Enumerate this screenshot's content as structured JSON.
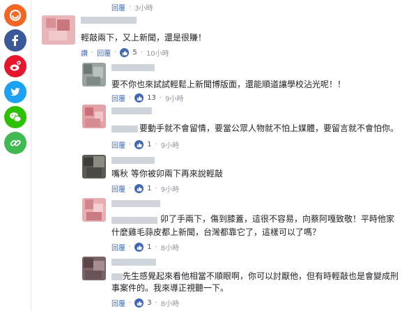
{
  "share": {
    "buttons": [
      {
        "name": "weibo-alt-icon",
        "color": "#f26522",
        "glyph": "◉"
      },
      {
        "name": "facebook-icon",
        "color": "#3b5998",
        "glyph": "f"
      },
      {
        "name": "weibo-icon",
        "color": "#e6162d",
        "glyph": "◎"
      },
      {
        "name": "twitter-icon",
        "color": "#1da1f2",
        "glyph": "✦"
      },
      {
        "name": "wechat-icon",
        "color": "#2dc100",
        "glyph": "✆"
      },
      {
        "name": "link-icon",
        "color": "#3fb950",
        "glyph": "∞"
      }
    ]
  },
  "top_actions": {
    "reply": "回覆",
    "time": "3小時"
  },
  "comments": [
    {
      "text": "輕敲兩下，又上新聞，還是很賺！",
      "like": "讚",
      "reply": "回覆",
      "count": "5",
      "time": "10小時"
    },
    {
      "text": "要不你也來試試輕鬆上新聞博版面，還能順道讓學校沾光呢！！",
      "reply": "回覆",
      "count": "13",
      "time": "9小時"
    },
    {
      "text": "要動手就不會留情，要當公眾人物就不怕上媒體，要留言就不會怕你。",
      "reply": "回覆",
      "count": "1",
      "time": "9小時"
    },
    {
      "text": "嘴秋 等你被卯兩下再來說輕敲",
      "reply": "回覆",
      "count": "1",
      "time": "9小時"
    },
    {
      "text_line1": "卯了手兩下，傷到膝蓋，這很不容易，向蔡阿嘎致敬！平時他家",
      "text_line2": "什麼雞毛蒜皮都上新聞，台灣都靠它了，這樣可以了嗎？",
      "reply": "回覆",
      "count": "1",
      "time": "8小時"
    },
    {
      "text_line1": "先生感覺起來看他相當不順眼啊，你可以討厭他，但有時輕敲也是會變成刑",
      "text_line2": "事案件的。我來導正視聽一下。",
      "reply": "回覆",
      "count": "3",
      "time": "8小時"
    }
  ]
}
